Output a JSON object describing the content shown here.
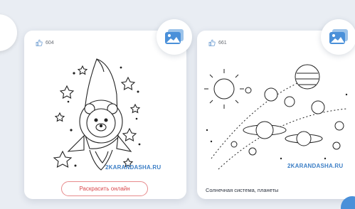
{
  "cards": [
    {
      "likes": "604",
      "watermark": "2KARANDASHA.RU",
      "button_label": "Раскрасить онлайн"
    },
    {
      "likes": "661",
      "watermark": "2KARANDASHA.RU",
      "caption": "Солнечная система, планеты"
    }
  ],
  "icons": {
    "like": "thumbs-up-icon",
    "gallery": "image-gallery-icon"
  },
  "colors": {
    "background": "#e9edf3",
    "accent": "#4a90d9",
    "button_border": "#e78a8c",
    "button_text": "#d9474b"
  }
}
